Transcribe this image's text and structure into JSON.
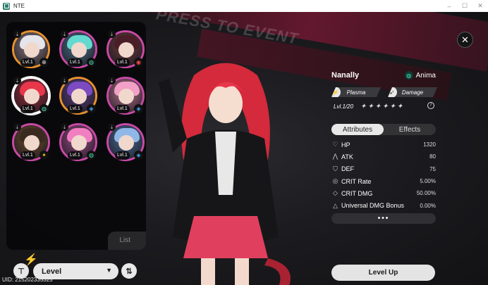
{
  "window": {
    "title": "NTE",
    "controls": [
      "–",
      "☐",
      "✕"
    ]
  },
  "background": {
    "banner_text": "PRESS TO EVENT"
  },
  "roster": {
    "list_label": "List",
    "cards": [
      {
        "level": "Lvl.1",
        "element": "⊕",
        "ring": "#e8912f",
        "hair": "#e4e4ea",
        "bg": "#8a7780",
        "selected": false,
        "elem_color": "#ddd"
      },
      {
        "level": "Lvl.1",
        "element": "◍",
        "ring": "#c94aa6",
        "hair": "#64d9d0",
        "bg": "#4b6e88",
        "selected": false,
        "elem_color": "#4ee0b8"
      },
      {
        "level": "Lvl.1",
        "element": "◉",
        "ring": "#c94aa6",
        "hair": "#4a1e28",
        "bg": "#6b3a3e",
        "selected": false,
        "elem_color": "#ff4c4c"
      },
      {
        "level": "Lvl.1",
        "element": "◍",
        "ring": "#ffffff",
        "hair": "#e8364a",
        "bg": "#9c2a3a",
        "selected": true,
        "elem_color": "#4ee0b8"
      },
      {
        "level": "Lvl.1",
        "element": "◈",
        "ring": "#e8912f",
        "hair": "#7c4bc2",
        "bg": "#5a3c82",
        "selected": false,
        "elem_color": "#4aa8ff"
      },
      {
        "level": "Lvl.1",
        "element": "◈",
        "ring": "#c94aa6",
        "hair": "#f2a0c6",
        "bg": "#b9708e",
        "selected": false,
        "elem_color": "#4aa8ff"
      },
      {
        "level": "Lvl.1",
        "element": "✦",
        "ring": "#c94aa6",
        "hair": "#3a2a20",
        "bg": "#6e4a2e",
        "selected": false,
        "elem_color": "#f4c21a"
      },
      {
        "level": "Lvl.1",
        "element": "◍",
        "ring": "#c94aa6",
        "hair": "#f27ec2",
        "bg": "#9c4a86",
        "selected": false,
        "elem_color": "#4ee0b8"
      },
      {
        "level": "Lvl.1",
        "element": "◈",
        "ring": "#c94aa6",
        "hair": "#8fb8e8",
        "bg": "#4b6a9a",
        "selected": false,
        "elem_color": "#4aa8ff"
      }
    ]
  },
  "controls": {
    "sort_value": "Level",
    "uid": "UID: 215202335325"
  },
  "character": {
    "name": "Nanally",
    "element": "Anima",
    "tags": [
      "Plasma",
      "Damage"
    ],
    "level": "Lvl.1/20",
    "stars": "✦✦✦✦✦✦",
    "tabs": [
      "Attributes",
      "Effects"
    ],
    "active_tab": 0,
    "stats": [
      {
        "icon": "♡",
        "label": "HP",
        "value": "1320"
      },
      {
        "icon": "⋀",
        "label": "ATK",
        "value": "80"
      },
      {
        "icon": "⛉",
        "label": "DEF",
        "value": "75"
      },
      {
        "icon": "◎",
        "label": "CRIT Rate",
        "value": "5.00%"
      },
      {
        "icon": "◇",
        "label": "CRIT DMG",
        "value": "50.00%"
      },
      {
        "icon": "△",
        "label": "Universal DMG Bonus",
        "value": "0.00%"
      }
    ],
    "more_label": "•••",
    "level_up_label": "Level Up"
  },
  "icons": {
    "app": "app-icon",
    "close": "✕",
    "filter": "⊤",
    "order": "⇅",
    "caret": "▼",
    "anima": "◍",
    "plasma": "⚡",
    "damage": "➶",
    "lock": "!"
  }
}
